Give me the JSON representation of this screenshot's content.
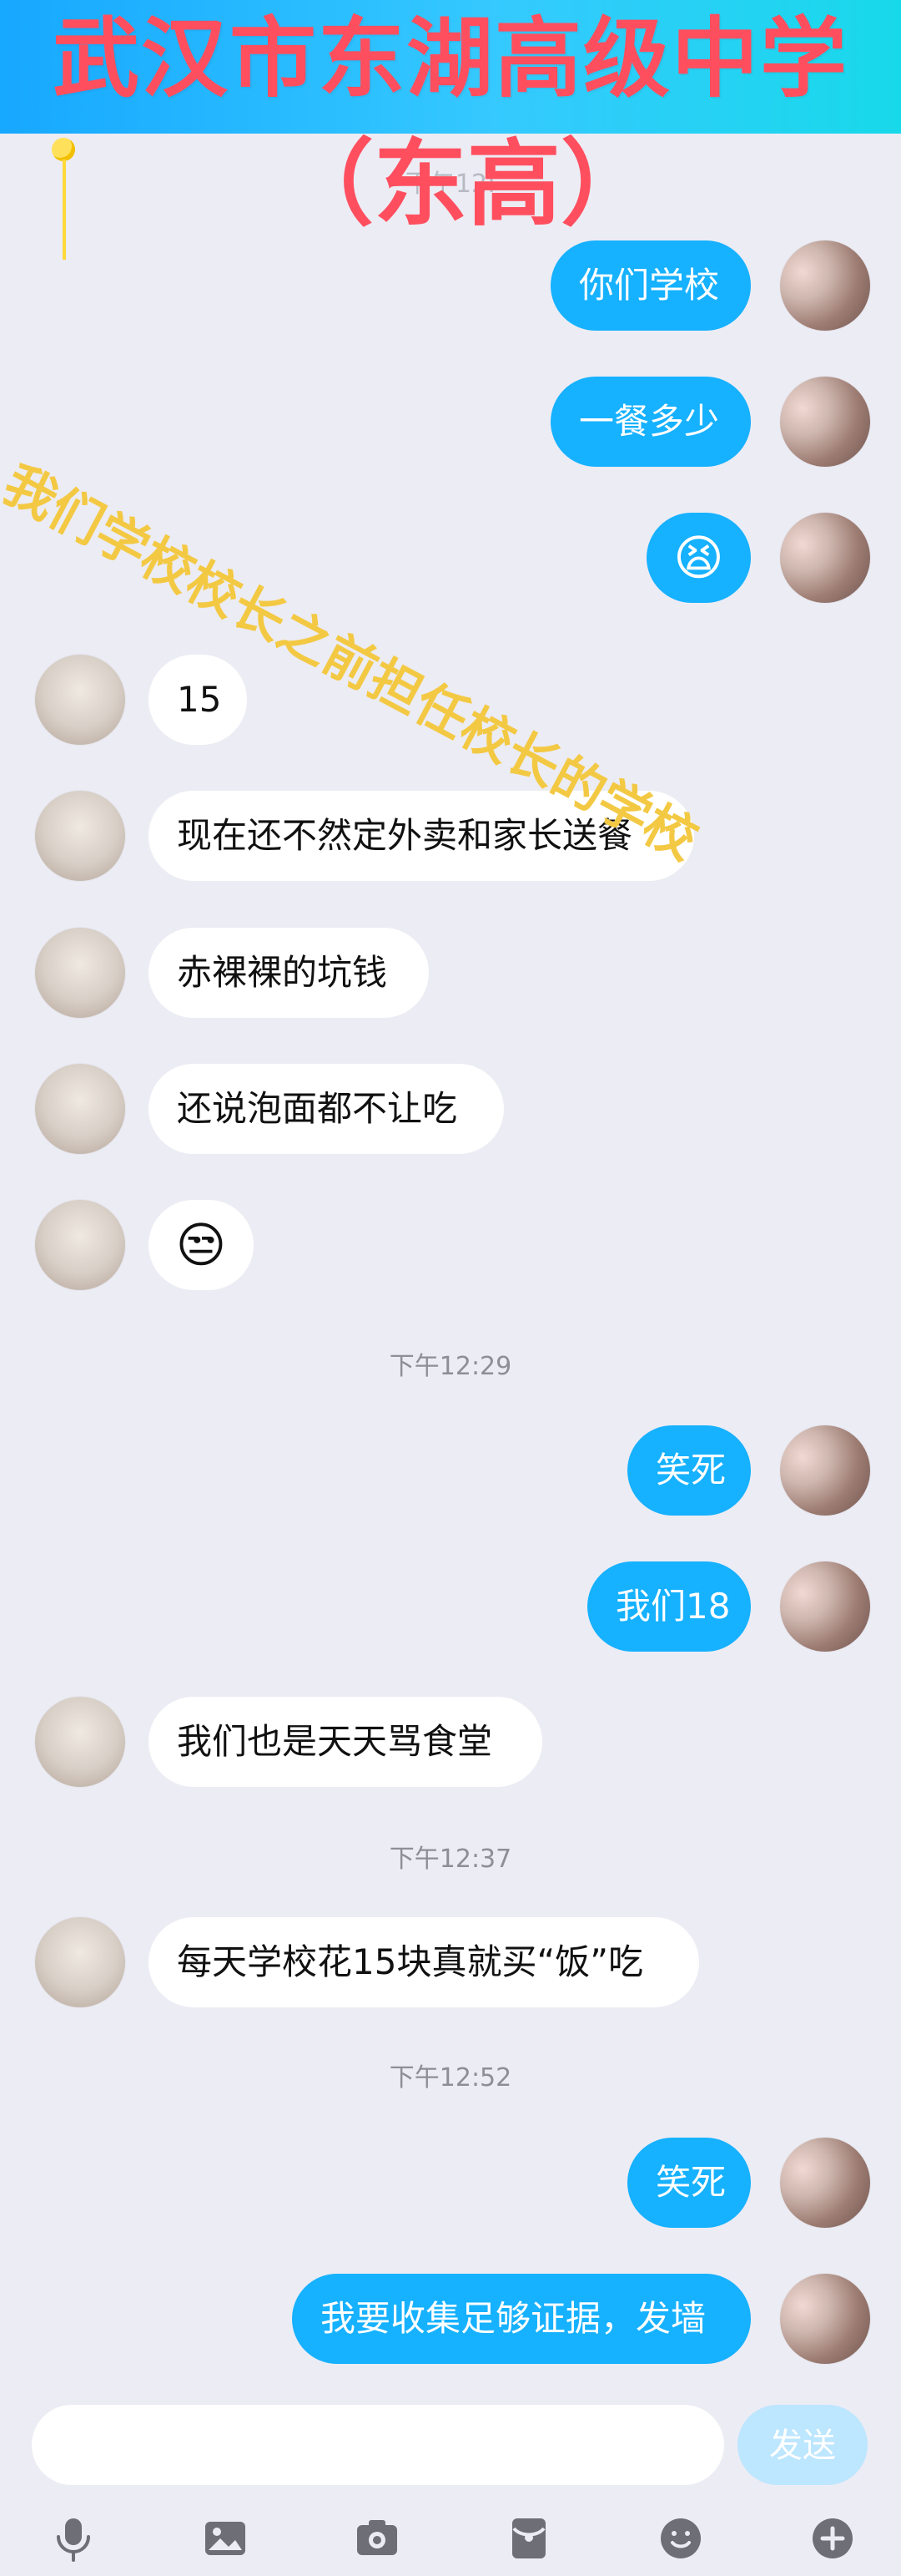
{
  "overlay": {
    "title": "武汉市东湖高级中学",
    "subtitle": "（东高）",
    "diagonal_note": "我们学校校长之前担任校长的学校",
    "hidden_time": "下午12:"
  },
  "timestamps": {
    "t1": "下午12:29",
    "t2": "下午12:37",
    "t3": "下午12:52"
  },
  "messages": [
    {
      "side": "self",
      "text": "你们学校"
    },
    {
      "side": "self",
      "text": "一餐多少"
    },
    {
      "side": "self",
      "emoji": "😫"
    },
    {
      "side": "other",
      "text": "15"
    },
    {
      "side": "other",
      "text": "现在还不然定外卖和家长送餐"
    },
    {
      "side": "other",
      "text": "赤裸裸的坑钱"
    },
    {
      "side": "other",
      "text": "还说泡面都不让吃"
    },
    {
      "side": "other",
      "emoji": "😒"
    },
    {
      "side": "self",
      "text": "笑死"
    },
    {
      "side": "self",
      "text": "我们18"
    },
    {
      "side": "other",
      "text": "我们也是天天骂食堂"
    },
    {
      "side": "other",
      "text": "每天学校花15块真就买“饭”吃"
    },
    {
      "side": "self",
      "text": "笑死"
    },
    {
      "side": "self",
      "text": "我要收集足够证据，发墙"
    }
  ],
  "composer": {
    "input_value": "",
    "send_label": "发送"
  },
  "toolbar": {
    "icons": [
      "microphone-icon",
      "image-icon",
      "camera-icon",
      "red-packet-icon",
      "emoji-icon",
      "plus-icon"
    ]
  },
  "colors": {
    "background": "#ececf4",
    "self_bubble": "#16b1ff",
    "other_bubble": "#ffffff",
    "overlay_red": "#ff4f5f",
    "overlay_yellow": "#f3c944"
  }
}
